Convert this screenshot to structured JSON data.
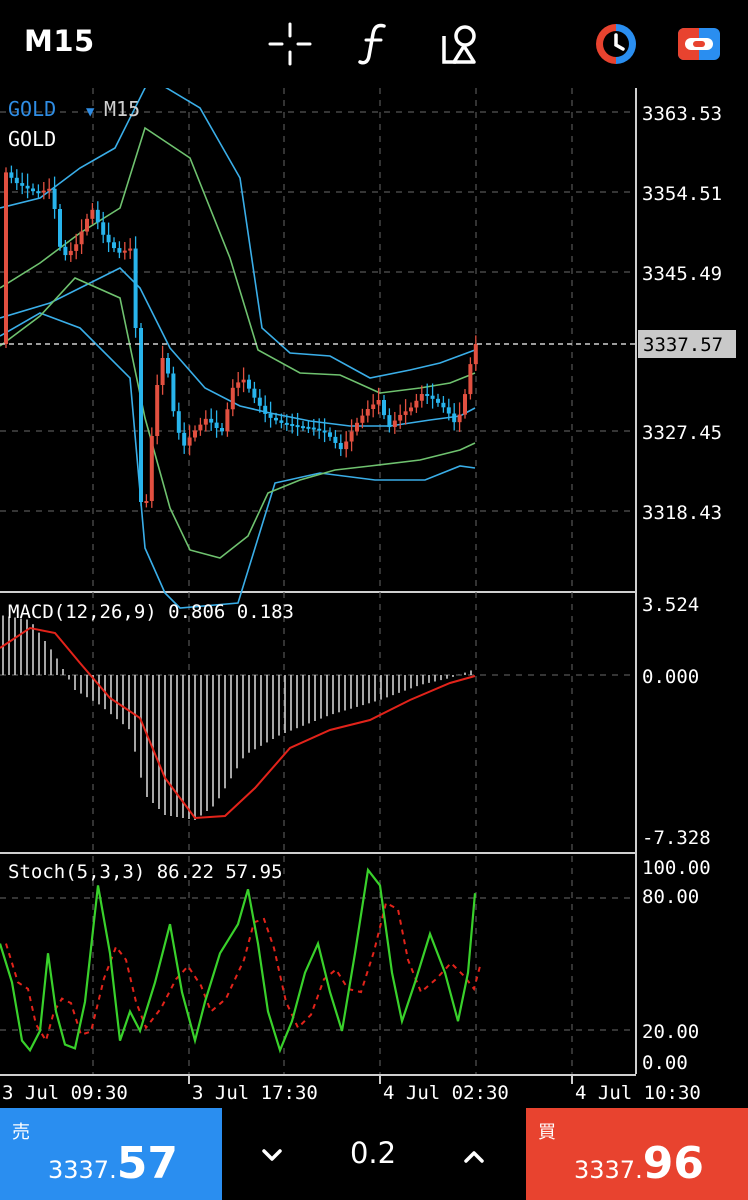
{
  "toolbar": {
    "timeframe": "M15",
    "icons": [
      "crosshair-icon",
      "function-icon",
      "objects-icon",
      "clock-icon",
      "trade-toggle-icon"
    ]
  },
  "chart": {
    "symbol_label": "GOLD",
    "symbol_tf": "M15",
    "indicator_name": "GOLD",
    "price_ticks": [
      "3363.53",
      "3354.51",
      "3345.49",
      "3327.45",
      "3318.43"
    ],
    "current_price": "3337.57",
    "colors": {
      "bull": "#e25040",
      "bear": "#28b4ec",
      "bollinger_outer": "#3aaee8",
      "bollinger_inner": "#6fc26f",
      "macd_signal": "#e2231a",
      "stoch_main": "#39d12b",
      "stoch_signal": "#e2231a"
    }
  },
  "macd": {
    "label": "MACD(12,26,9) 0.806 0.183",
    "ticks": [
      "3.524",
      "0.000",
      "-7.328"
    ]
  },
  "stoch": {
    "label": "Stoch(5,3,3) 86.22 57.95",
    "ticks": [
      "100.00",
      "80.00",
      "20.00",
      "0.00"
    ]
  },
  "time_axis": [
    "3 Jul 09:30",
    "3 Jul 17:30",
    "4 Jul 02:30",
    "4 Jul 10:30"
  ],
  "trade": {
    "sell_label": "売",
    "sell_price_prefix": "3337.",
    "sell_price_big": "57",
    "volume": "0.2",
    "buy_label": "買",
    "buy_price_prefix": "3337.",
    "buy_price_big": "96"
  }
}
